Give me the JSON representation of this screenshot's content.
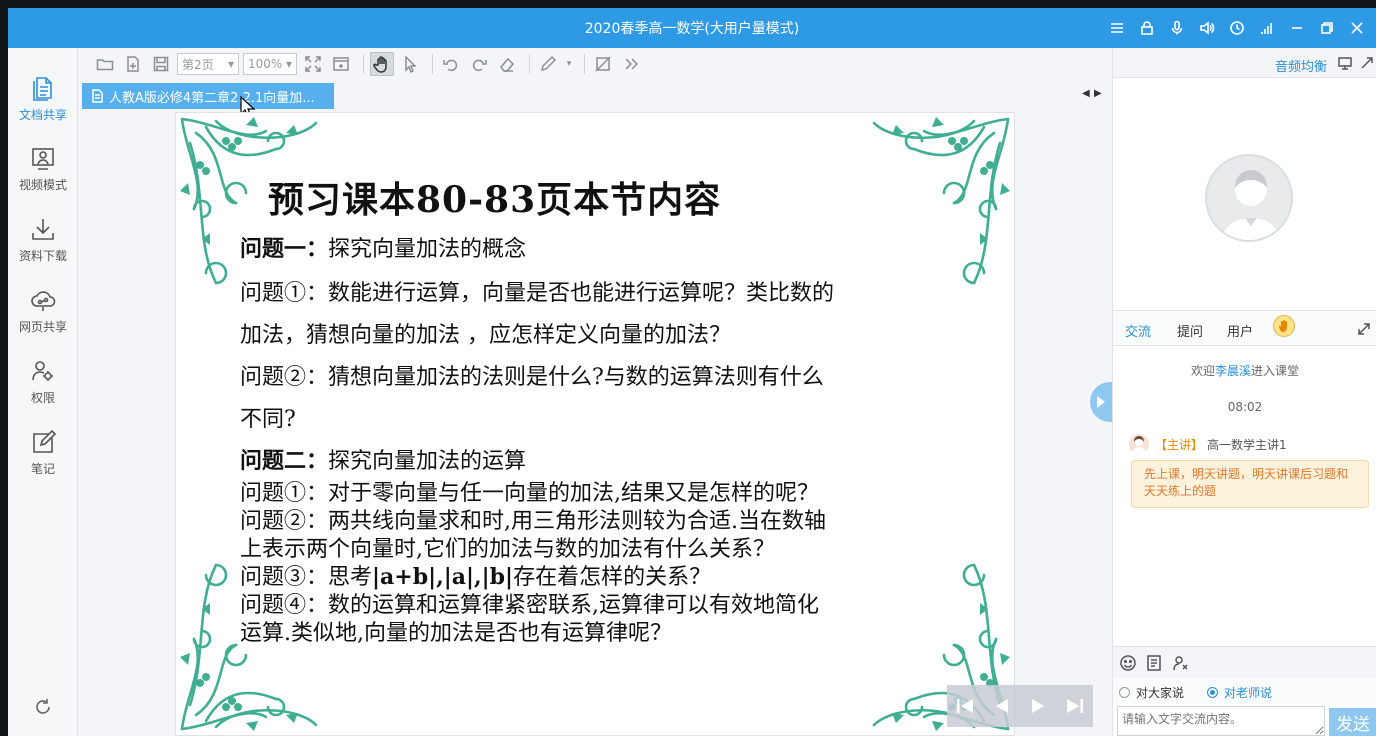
{
  "window": {
    "title": "2020春季高一数学(大用户量模式)",
    "controls": [
      "menu-icon",
      "lock-icon",
      "microphone-icon",
      "speaker-icon",
      "clock-icon",
      "signal-icon",
      "minimize-icon",
      "restore-icon",
      "close-icon"
    ]
  },
  "sidebar": {
    "items": [
      {
        "label": "文档共享",
        "icon": "document-icon",
        "active": true
      },
      {
        "label": "视频模式",
        "icon": "video-mode-icon"
      },
      {
        "label": "资料下载",
        "icon": "download-icon"
      },
      {
        "label": "网页共享",
        "icon": "web-share-icon"
      },
      {
        "label": "权限",
        "icon": "permission-icon"
      },
      {
        "label": "笔记",
        "icon": "note-icon"
      }
    ]
  },
  "toolbar": {
    "page_select": "第2页",
    "zoom_select": "100%"
  },
  "document_tab": {
    "label": "人教A版必修4第二章2.2.1向量加..."
  },
  "slide": {
    "title": "预习课本80-83页本节内容",
    "lines": [
      {
        "bold": "问题一：",
        "text": "探究向量加法的概念"
      },
      {
        "bold": "",
        "text": "问题①：数能进行运算，向量是否也能进行运算呢？类比数的"
      },
      {
        "bold": "",
        "text": "加法，猜想向量的加法 ，应怎样定义向量的加法？"
      },
      {
        "bold": "",
        "text": "问题②：猜想向量加法的法则是什么?与数的运算法则有什么"
      },
      {
        "bold": "",
        "text": "不同?"
      },
      {
        "bold": "问题二：",
        "text": "探究向量加法的运算"
      },
      {
        "bold": "",
        "text": "问题①：对于零向量与任一向量的加法,结果又是怎样的呢？"
      },
      {
        "bold": "",
        "text": "问题②：两共线向量求和时,用三角形法则较为合适.当在数轴"
      },
      {
        "bold": "",
        "text": "上表示两个向量时,它们的加法与数的加法有什么关系？"
      },
      {
        "bold": "",
        "text": "问题③：思考",
        "bold2": "|a+b|,|a|,|b|",
        "text2": "存在着怎样的关系？"
      },
      {
        "bold": "",
        "text": "问题④：数的运算和运算律紧密联系,运算律可以有效地简化"
      },
      {
        "bold": "",
        "text": "运算.类似地,向量的加法是否也有运算律呢？"
      }
    ]
  },
  "right_panel": {
    "audio_balance": "音频均衡",
    "tabs": [
      "交流",
      "提问",
      "用户"
    ],
    "active_tab": "交流",
    "chat": {
      "welcome_prefix": "欢迎",
      "welcome_name": "李晨溪",
      "welcome_suffix": "进入课堂",
      "time": "08:02",
      "message": {
        "role": "【主讲】",
        "sender": "高一数学主讲1",
        "text": "先上课，明天讲题，明天讲课后习题和天天练上的题"
      }
    },
    "send_options": [
      "对大家说",
      "对老师说"
    ],
    "selected_option": "对老师说",
    "input_placeholder": "请输入文字交流内容。",
    "send_label": "发送"
  },
  "colors": {
    "titlebar": "#2e9ae6",
    "accent": "#2b8fd8",
    "ornament": "#3fae93",
    "teacher_bubble": "#fdf3dc"
  }
}
